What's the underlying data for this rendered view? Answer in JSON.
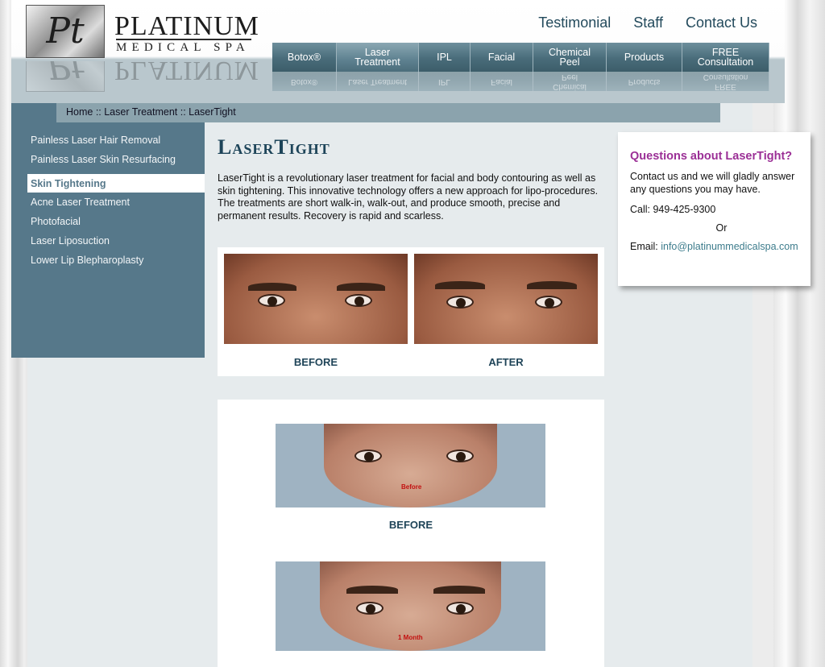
{
  "logo": {
    "monogram": "Pt",
    "name": "PLATINUM",
    "sub": "MEDICAL SPA"
  },
  "top_links": [
    "Testimonial",
    "Staff",
    "Contact Us"
  ],
  "nav": [
    {
      "label": "Botox®"
    },
    {
      "label": "Laser Treatment"
    },
    {
      "label": "IPL"
    },
    {
      "label": "Facial"
    },
    {
      "label": "Chemical Peel"
    },
    {
      "label": "Products"
    },
    {
      "label": "FREE Consultation"
    }
  ],
  "breadcrumb": "Home :: Laser Treatment :: LaserTight",
  "sidebar": {
    "items": [
      "Painless Laser Hair Removal",
      "Painless Laser Skin Resurfacing",
      "Skin Tightening",
      "Acne Laser Treatment",
      "Photofacial",
      "Laser Liposuction",
      "Lower Lip Blepharoplasty"
    ]
  },
  "main": {
    "title": "LaserTight",
    "intro": "LaserTight is a revolutionary laser treatment for facial and body contouring as well as skin tightening. This innovative technology offers a new approach for lipo-procedures. The treatments are short walk-in, walk-out, and produce smooth, precise and permanent results. Recovery is rapid and scarless.",
    "photo1_before": "BEFORE",
    "photo1_after": "AFTER",
    "photo2_label": "Before",
    "photo2_caption": "BEFORE",
    "photo3_label": "1 Month"
  },
  "panel": {
    "title": "Questions about LaserTight?",
    "text": "Contact us and we will gladly answer any questions you may have.",
    "call": "Call: 949-425-9300",
    "or": "Or",
    "email_prefix": "Email:",
    "email": "info@platinummedicalspa.com"
  },
  "colors": {
    "accent": "#56788a",
    "title": "#1d4459",
    "question": "#9b2f96",
    "link": "#3d7c8c"
  }
}
